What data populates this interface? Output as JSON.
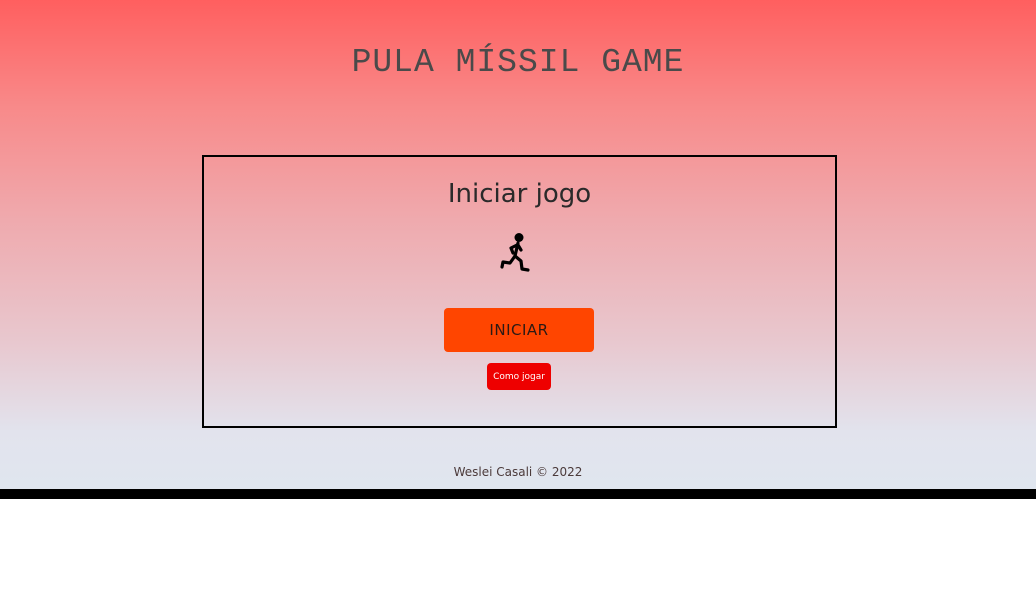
{
  "header": {
    "title": "PULA MÍSSIL GAME"
  },
  "start_panel": {
    "heading": "Iniciar jogo",
    "icon": "running-person-icon",
    "start_label": "INICIAR",
    "how_to_play_label": "Como jogar"
  },
  "footer": {
    "credit": "Weslei Casali © 2022"
  },
  "colors": {
    "gradient_top": "#ff5f5f",
    "gradient_bottom": "#e0e6ef",
    "start_button": "#ff4500",
    "how_to_play_button": "#ee0000",
    "panel_border": "#000000"
  }
}
